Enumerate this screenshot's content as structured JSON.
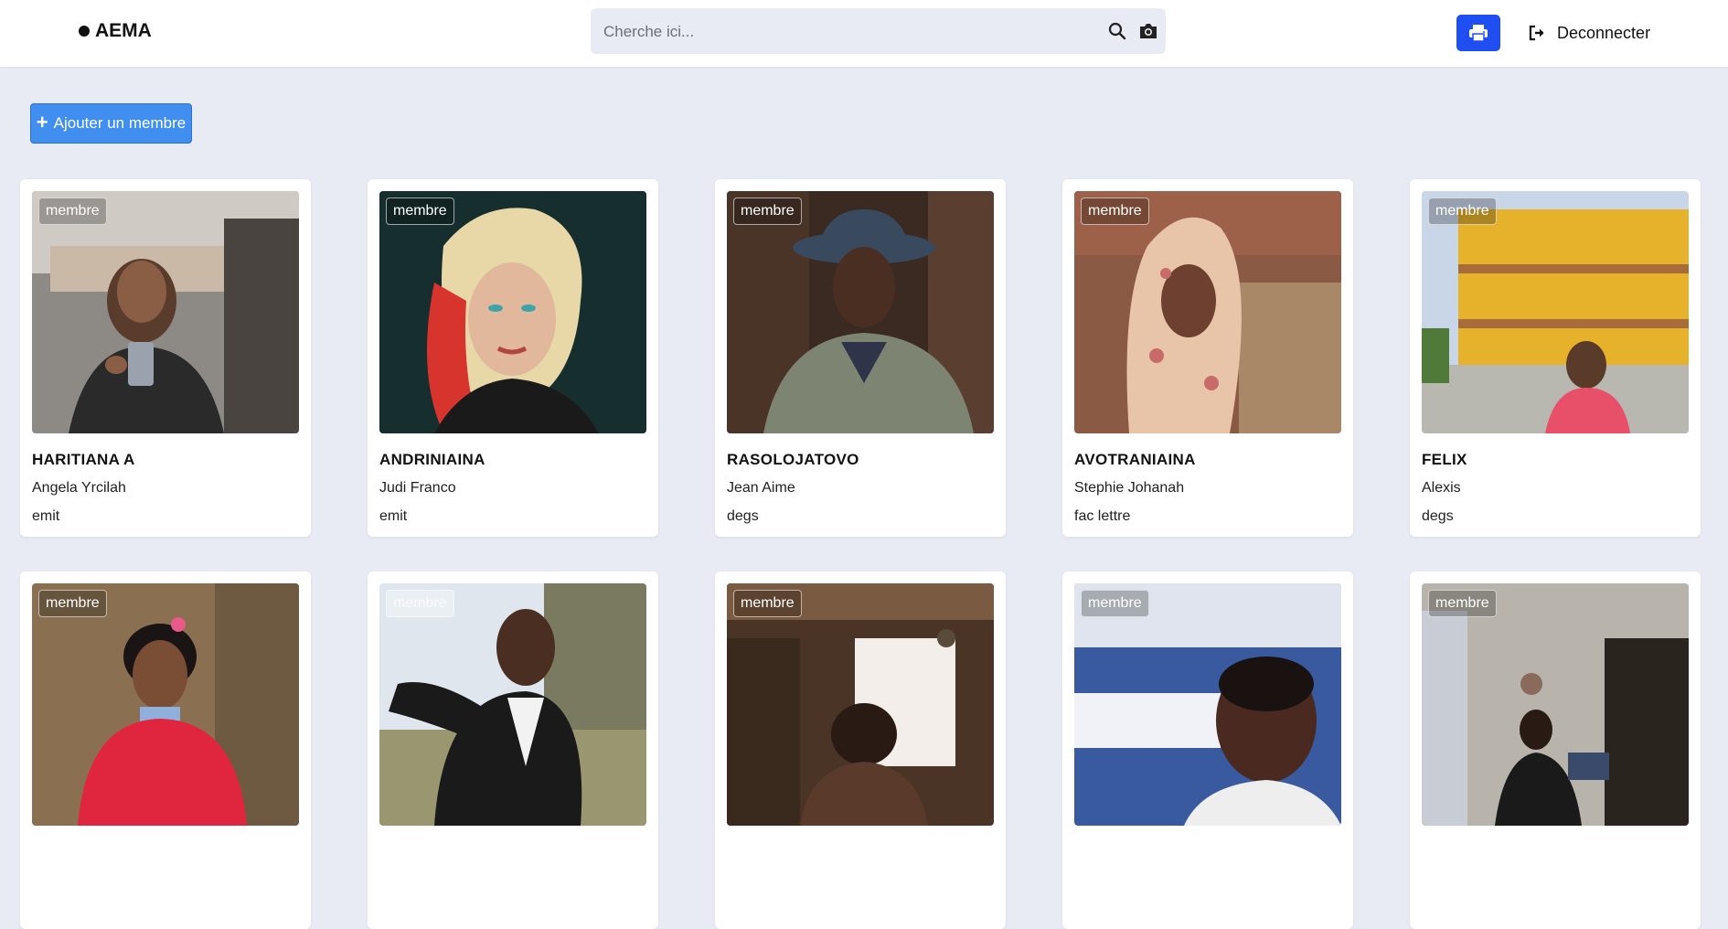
{
  "header": {
    "brand": "AEMA",
    "search_placeholder": "Cherche ici...",
    "logout_label": "Deconnecter"
  },
  "actions": {
    "add_member_label": "Ajouter un membre"
  },
  "members": [
    {
      "role": "membre",
      "last_name": "HARITIANA A",
      "first_name": "Angela Yrcilah",
      "school": "emit"
    },
    {
      "role": "membre",
      "last_name": "ANDRINIAINA",
      "first_name": "Judi Franco",
      "school": "emit"
    },
    {
      "role": "membre",
      "last_name": "RASOLOJATOVO",
      "first_name": "Jean Aime",
      "school": "degs"
    },
    {
      "role": "membre",
      "last_name": "AVOTRANIAINA",
      "first_name": "Stephie Johanah",
      "school": "fac lettre"
    },
    {
      "role": "membre",
      "last_name": "FELIX",
      "first_name": "Alexis",
      "school": "degs"
    },
    {
      "role": "membre"
    },
    {
      "role": "membre"
    },
    {
      "role": "membre"
    },
    {
      "role": "membre"
    },
    {
      "role": "membre"
    }
  ]
}
